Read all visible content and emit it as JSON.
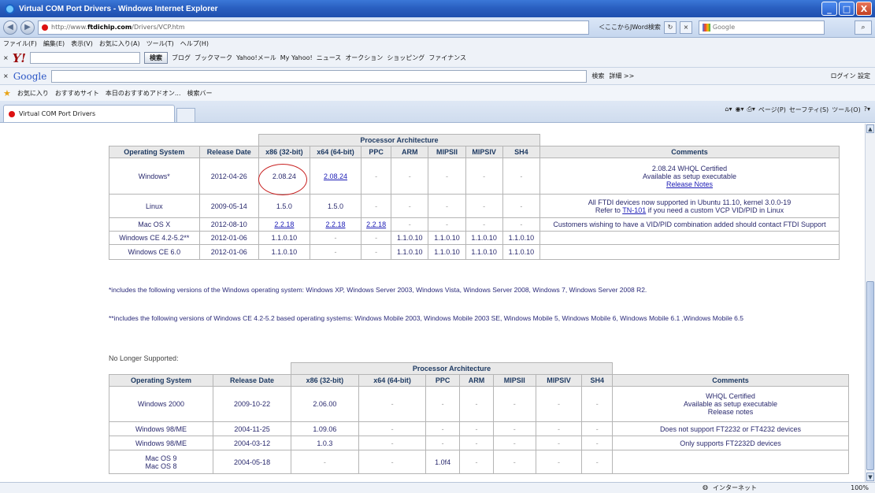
{
  "window": {
    "title": "Virtual COM Port Drivers - Windows Internet Explorer",
    "min": "_",
    "max": "□",
    "close": "X"
  },
  "address": {
    "url_prefix": "http://www.",
    "url_host": "ftdichip.com",
    "url_path": "/Drivers/VCP.htm",
    "search_hint": "＜ここからJWord検索",
    "search_placeholder": "Google"
  },
  "menu": [
    "ファイル(F)",
    "編集(E)",
    "表示(V)",
    "お気に入り(A)",
    "ツール(T)",
    "ヘルプ(H)"
  ],
  "yahoo_bar": {
    "search_btn": "検索",
    "items": [
      "ブログ",
      "ブックマーク",
      "Yahoo!メール",
      "My Yahoo!",
      "ニュース",
      "オークション",
      "ショッピング",
      "ファイナンス"
    ]
  },
  "google_bar": {
    "logo": "Google",
    "search": "検索",
    "detail": "詳細 >>",
    "login": "ログイン",
    "settings": "設定"
  },
  "favorites_bar": {
    "favorites": "お気に入り",
    "items": [
      "おすすめサイト",
      "本日のおすすめアドオン...",
      "検索バー"
    ]
  },
  "tab": {
    "label": "Virtual COM Port Drivers"
  },
  "command_bar": [
    "ページ(P)",
    "セーフティ(S)",
    "ツール(O)"
  ],
  "current_table": {
    "group_header": "Processor Architecture",
    "headers": [
      "Operating System",
      "Release Date",
      "x86 (32-bit)",
      "x64 (64-bit)",
      "PPC",
      "ARM",
      "MIPSII",
      "MIPSIV",
      "SH4",
      "Comments"
    ],
    "rows": [
      {
        "os": "Windows*",
        "date": "2012-04-26",
        "cells": [
          "2.08.24",
          "2.08.24",
          "-",
          "-",
          "-",
          "-",
          "-"
        ],
        "comments": [
          "2.08.24 WHQL Certified",
          "Available as setup executable",
          "Release Notes"
        ]
      },
      {
        "os": "Linux",
        "date": "2009-05-14",
        "cells": [
          "1.5.0",
          "1.5.0",
          "-",
          "-",
          "-",
          "-",
          "-"
        ],
        "comments": [
          "All FTDI devices now supported in Ubuntu 11.10, kernel 3.0.0-19",
          "Refer to TN-101 if you need a custom VCP VID/PID in Linux"
        ]
      },
      {
        "os": "Mac OS X",
        "date": "2012-08-10",
        "cells": [
          "2.2.18",
          "2.2.18",
          "2.2.18",
          "-",
          "-",
          "-",
          "-"
        ],
        "comments": [
          "Customers wishing to have a VID/PID combination added should contact FTDI Support"
        ]
      },
      {
        "os": "Windows CE 4.2-5.2**",
        "date": "2012-01-06",
        "cells": [
          "1.1.0.10",
          "-",
          "-",
          "1.1.0.10",
          "1.1.0.10",
          "1.1.0.10",
          "1.1.0.10"
        ],
        "comments": [
          ""
        ]
      },
      {
        "os": "Windows CE 6.0",
        "date": "2012-01-06",
        "cells": [
          "1.1.0.10",
          "-",
          "-",
          "1.1.0.10",
          "1.1.0.10",
          "1.1.0.10",
          "1.1.0.10"
        ],
        "comments": [
          ""
        ]
      }
    ]
  },
  "notes": {
    "windows": "*includes the following versions of the Windows operating system: Windows XP, Windows Server 2003, Windows Vista, Windows Server 2008, Windows 7, Windows Server 2008 R2.",
    "wince": "**includes the following versions of Windows CE 4.2-5.2 based operating systems: Windows Mobile 2003, Windows Mobile 2003 SE, Windows Mobile 5, Windows Mobile 6, Windows Mobile 6.1 ,Windows Mobile 6.5"
  },
  "legacy_label": "No Longer Supported:",
  "legacy_table": {
    "group_header": "Processor Architecture",
    "headers": [
      "Operating System",
      "Release Date",
      "x86 (32-bit)",
      "x64 (64-bit)",
      "PPC",
      "ARM",
      "MIPSII",
      "MIPSIV",
      "SH4",
      "Comments"
    ],
    "rows": [
      {
        "os": "Windows 2000",
        "date": "2009-10-22",
        "cells": [
          "2.06.00",
          "-",
          "-",
          "-",
          "-",
          "-",
          "-"
        ],
        "comments": [
          "WHQL Certified",
          "Available as setup executable",
          "Release notes"
        ]
      },
      {
        "os": "Windows 98/ME",
        "date": "2004-11-25",
        "cells": [
          "1.09.06",
          "-",
          "-",
          "-",
          "-",
          "-",
          "-"
        ],
        "comments": [
          "Does not support FT2232 or FT4232 devices"
        ]
      },
      {
        "os": "Windows 98/ME",
        "date": "2004-03-12",
        "cells": [
          "1.0.3",
          "-",
          "-",
          "-",
          "-",
          "-",
          "-"
        ],
        "comments": [
          "Only supports FT2232D devices"
        ]
      },
      {
        "os": "Mac OS 9\nMac OS 8",
        "date": "2004-05-18",
        "cells": [
          "-",
          "-",
          "1.0f4",
          "-",
          "-",
          "-",
          "-"
        ],
        "comments": [
          ""
        ]
      }
    ]
  },
  "status": {
    "zone": "インターネット",
    "zoom": "100%"
  }
}
